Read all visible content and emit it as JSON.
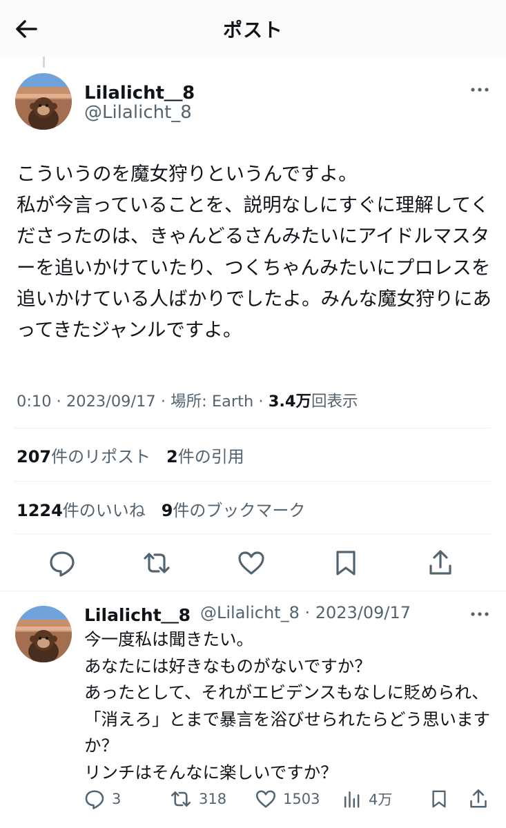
{
  "header": {
    "title": "ポスト",
    "back_icon": "arrow-left-icon"
  },
  "post": {
    "author_name": "Lilalicht＿8",
    "author_handle": "@Lilalicht_8",
    "text": "こういうのを魔女狩りというんですよ。\n私が今言っていることを、説明なしにすぐに理解してくださったのは、きゃんどるさんみたいにアイドルマスターを追いかけていたり、つくちゃんみたいにプロレスを追いかけている人ばかりでしたよ。みんな魔女狩りにあってきたジャンルですよ。",
    "meta_time": "0:10 · 2023/09/17",
    "meta_place": "場所: Earth",
    "meta_sep": " · ",
    "views_count": "3.4万",
    "views_label": "回表示",
    "reposts_count": "207",
    "reposts_label": "件のリポスト",
    "quotes_count": "2",
    "quotes_label": "件の引用",
    "likes_count": "1224",
    "likes_label": "件のいいね",
    "bookmarks_count": "9",
    "bookmarks_label": "件のブックマーク"
  },
  "reply": {
    "author_name": "Lilalicht＿8",
    "author_handle_date": "@Lilalicht_8 · 2023/09/17",
    "text": "今一度私は聞きたい。\nあなたには好きなものがないですか？\nあったとして、それがエビデンスもなしに貶められ、「消えろ」とまで暴言を浴びせられたらどう思いますか？\nリンチはそんなに楽しいですか？",
    "replies": "3",
    "reposts": "318",
    "likes": "1503",
    "views": "4万"
  },
  "colors": {
    "text": "#0f1419",
    "secondary": "#536471",
    "divider": "#eff3f4"
  }
}
